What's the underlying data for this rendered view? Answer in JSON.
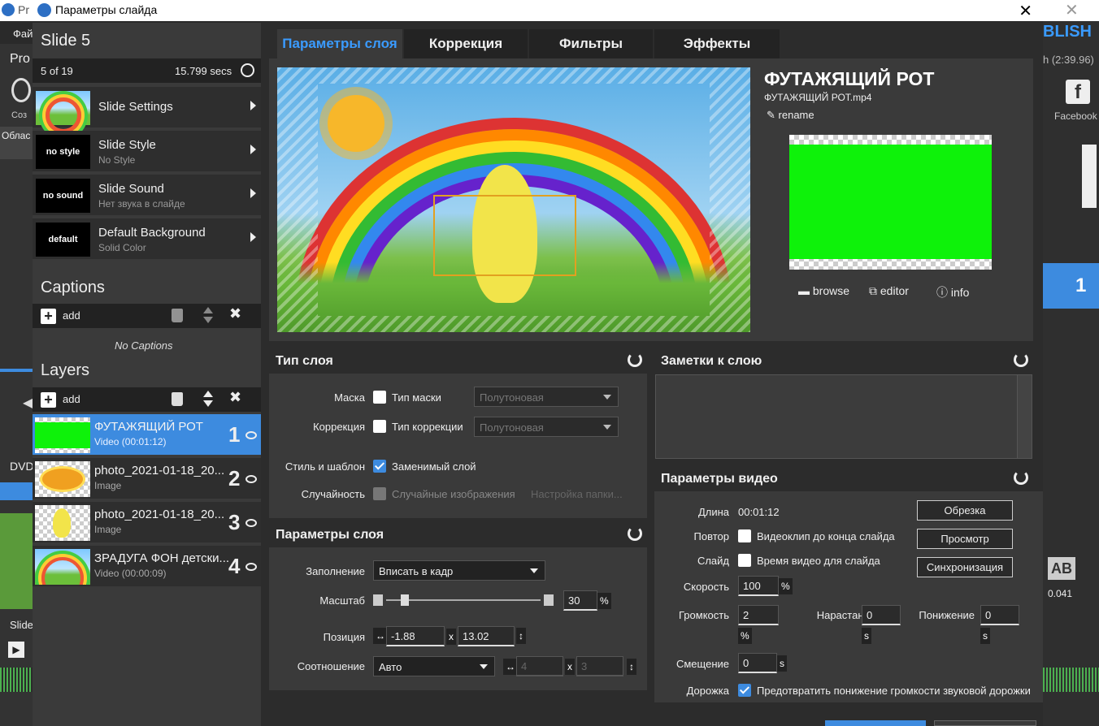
{
  "window": {
    "title": "Параметры слайда"
  },
  "background_app": {
    "title_fragment": "Pr",
    "left_labels": [
      "Фай",
      "Pro",
      "Соз",
      "Облас",
      "DVD",
      "Slide"
    ],
    "right_labels": {
      "publish": "BLISH",
      "duration": "h (2:39.96)",
      "facebook": "Facebook",
      "slide_number": "1",
      "ab_value": "0.041"
    }
  },
  "sidebar": {
    "slide_title": "Slide 5",
    "slide_position": "5 of 19",
    "slide_duration": "15.799 secs",
    "menu": [
      {
        "title": "Slide Settings",
        "subtitle": "",
        "thumb": ""
      },
      {
        "title": "Slide Style",
        "subtitle": "No Style",
        "thumb": "no style"
      },
      {
        "title": "Slide Sound",
        "subtitle": "Нет звука в слайде",
        "thumb": "no sound"
      },
      {
        "title": "Default Background",
        "subtitle": "Solid Color",
        "thumb": "default"
      }
    ],
    "captions": {
      "title": "Captions",
      "add": "add",
      "empty": "No Captions"
    },
    "layers": {
      "title": "Layers",
      "add": "add",
      "items": [
        {
          "name": "ФУТАЖЯЩИЙ РОТ",
          "type": "Video (00:01:12)",
          "num": "1",
          "selected": true
        },
        {
          "name": "photo_2021-01-18_20...",
          "type": "Image",
          "num": "2"
        },
        {
          "name": "photo_2021-01-18_20...",
          "type": "Image",
          "num": "3"
        },
        {
          "name": "ЗРАДУГА ФОН детски...",
          "type": "Video (00:00:09)",
          "num": "4"
        }
      ]
    }
  },
  "tabs": [
    {
      "label": "Параметры слоя",
      "active": true
    },
    {
      "label": "Коррекция"
    },
    {
      "label": "Фильтры"
    },
    {
      "label": "Эффекты"
    }
  ],
  "media": {
    "title": "ФУТАЖЯЩИЙ РОТ",
    "filename": "ФУТАЖЯЩИЙ РОТ.mp4",
    "rename": "rename",
    "browse": "browse",
    "editor": "editor",
    "info": "info"
  },
  "layer_type": {
    "title": "Тип слоя",
    "mask_label": "Маска",
    "mask_check": "Тип маски",
    "mask_select": "Полутоновая",
    "correction_label": "Коррекция",
    "correction_check": "Тип коррекции",
    "correction_select": "Полутоновая",
    "style_label": "Стиль и шаблон",
    "style_check": "Заменимый слой",
    "random_label": "Случайность",
    "random_check": "Случайные изображения",
    "random_link": "Настройка папки..."
  },
  "layer_params": {
    "title": "Параметры слоя",
    "fill_label": "Заполнение",
    "fill_value": "Вписать в кадр",
    "scale_label": "Масштаб",
    "scale_value": "30",
    "scale_unit": "%",
    "scale_level": 0.1,
    "position_label": "Позиция",
    "pos_x": "-1.88",
    "pos_sep": "x",
    "pos_y": "13.02",
    "ratio_label": "Соотношение",
    "ratio_value": "Авто",
    "ratio_w": "4",
    "ratio_sep": "x",
    "ratio_h": "3"
  },
  "notes": {
    "title": "Заметки к слою"
  },
  "video_params": {
    "title": "Параметры видео",
    "length_label": "Длина",
    "length_value": "00:01:12",
    "repeat_label": "Повтор",
    "repeat_check": "Видеоклип до конца слайда",
    "slide_label": "Слайд",
    "slide_check": "Время видео для слайда",
    "speed_label": "Скорость",
    "speed_value": "100",
    "speed_unit": "%",
    "volume_label": "Громкость",
    "volume_value": "2",
    "volume_unit": "%",
    "fadein_label": "Нарастание",
    "fadein_value": "0",
    "fadein_unit": "s",
    "fadeout_label": "Понижение",
    "fadeout_value": "0",
    "fadeout_unit": "s",
    "offset_label": "Смещение",
    "offset_value": "0",
    "offset_unit": "s",
    "track_label": "Дорожка",
    "track_check": "Предотвратить понижение громкости звуковой дорожки",
    "btn_trim": "Обрезка",
    "btn_preview": "Просмотр",
    "btn_sync": "Синхронизация"
  }
}
